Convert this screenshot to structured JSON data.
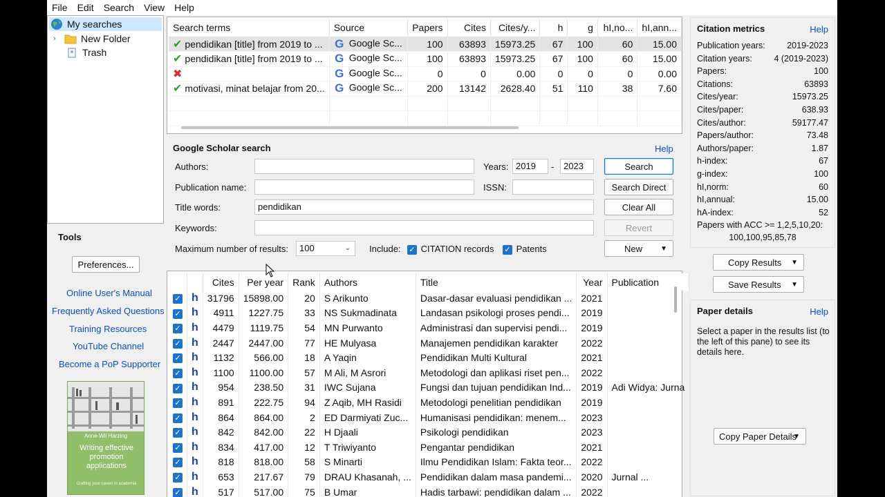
{
  "menu": [
    "File",
    "Edit",
    "Search",
    "View",
    "Help"
  ],
  "tree": [
    {
      "label": "My searches",
      "icon": "globe-icon"
    },
    {
      "label": "New Folder",
      "icon": "folder-icon"
    },
    {
      "label": "Trash",
      "icon": "trash-icon"
    }
  ],
  "tools": {
    "title": "Tools",
    "preferences": "Preferences...",
    "links": [
      "Online User's Manual",
      "Frequently Asked Questions",
      "Training Resources",
      "YouTube Channel",
      "Become a PoP Supporter"
    ],
    "book": {
      "author": "Anne-Wil Harzing",
      "title": "Writing effective promotion applications",
      "subtitle": "Crafting your career in academia"
    }
  },
  "searches": {
    "columns": [
      "Search terms",
      "Source",
      "Papers",
      "Cites",
      "Cites/y...",
      "h",
      "g",
      "hI,no...",
      "hI,ann..."
    ],
    "rows": [
      {
        "status": "ok",
        "terms": "pendidikan [title] from 2019 to ...",
        "source": "Google Sc...",
        "papers": "100",
        "cites": "63893",
        "cpy": "15973.25",
        "h": "67",
        "g": "100",
        "hinorm": "60",
        "hiann": "15.00"
      },
      {
        "status": "ok",
        "terms": "pendidikan [title] from 2019 to ...",
        "source": "Google Sc...",
        "papers": "100",
        "cites": "63893",
        "cpy": "15973.25",
        "h": "67",
        "g": "100",
        "hinorm": "60",
        "hiann": "15.00"
      },
      {
        "status": "error",
        "terms": "",
        "source": "Google Sc...",
        "papers": "0",
        "cites": "0",
        "cpy": "0.00",
        "h": "0",
        "g": "0",
        "hinorm": "0",
        "hiann": "0.00"
      },
      {
        "status": "ok",
        "terms": "motivasi, minat belajar from 20...",
        "source": "Google Sc...",
        "papers": "200",
        "cites": "13142",
        "cpy": "2628.40",
        "h": "51",
        "g": "110",
        "hinorm": "38",
        "hiann": "7.60"
      }
    ]
  },
  "gs": {
    "title": "Google Scholar search",
    "help": "Help",
    "authors_label": "Authors:",
    "authors_value": "",
    "pub_label": "Publication name:",
    "pub_value": "",
    "title_label": "Title words:",
    "title_value": "pendidikan",
    "keywords_label": "Keywords:",
    "keywords_value": "",
    "years_label": "Years:",
    "year_from": "2019",
    "year_dash": "-",
    "year_to": "2023",
    "issn_label": "ISSN:",
    "issn_value": "",
    "max_label": "Maximum number of results:",
    "max_value": "100",
    "include_label": "Include:",
    "citation_records": "CITATION records",
    "patents": "Patents",
    "btn_search": "Search",
    "btn_direct": "Search Direct",
    "btn_clear": "Clear All",
    "btn_revert": "Revert",
    "btn_new": "New"
  },
  "results": {
    "columns": [
      "Cites",
      "Per year",
      "Rank",
      "Authors",
      "Title",
      "Year",
      "Publication"
    ],
    "rows": [
      {
        "cites": "31796",
        "per_year": "15898.00",
        "rank": "20",
        "authors": "S Arikunto",
        "title": "Dasar-dasar evaluasi pendidikan ...",
        "year": "2021",
        "pub": ""
      },
      {
        "cites": "4911",
        "per_year": "1227.75",
        "rank": "33",
        "authors": "NS Sukmadinata",
        "title": "Landasan psikologi proses pendi...",
        "year": "2019",
        "pub": ""
      },
      {
        "cites": "4479",
        "per_year": "1119.75",
        "rank": "54",
        "authors": "MN Purwanto",
        "title": "Administrasi dan supervisi pendi...",
        "year": "2019",
        "pub": ""
      },
      {
        "cites": "2447",
        "per_year": "2447.00",
        "rank": "77",
        "authors": "HE Mulyasa",
        "title": "Manajemen pendidikan karakter",
        "year": "2022",
        "pub": ""
      },
      {
        "cites": "1132",
        "per_year": "566.00",
        "rank": "18",
        "authors": "A Yaqin",
        "title": "Pendidikan Multi Kultural",
        "year": "2021",
        "pub": ""
      },
      {
        "cites": "1100",
        "per_year": "1100.00",
        "rank": "57",
        "authors": "M Ali, M Asrori",
        "title": "Metodologi dan aplikasi riset pen...",
        "year": "2022",
        "pub": ""
      },
      {
        "cites": "954",
        "per_year": "238.50",
        "rank": "31",
        "authors": "IWC Sujana",
        "title": "Fungsi dan tujuan pendidikan Ind...",
        "year": "2019",
        "pub": "Adi Widya: Jurna"
      },
      {
        "cites": "891",
        "per_year": "222.75",
        "rank": "94",
        "authors": "Z Aqib, MH Rasidi",
        "title": "Metodologi penelitian pendidikan",
        "year": "2019",
        "pub": ""
      },
      {
        "cites": "864",
        "per_year": "864.00",
        "rank": "2",
        "authors": "ED Darmiyati Zuc...",
        "title": "Humanisasi pendidikan: menem...",
        "year": "2023",
        "pub": ""
      },
      {
        "cites": "842",
        "per_year": "842.00",
        "rank": "22",
        "authors": "H Djaali",
        "title": "Psikologi pendidikan",
        "year": "2023",
        "pub": ""
      },
      {
        "cites": "834",
        "per_year": "417.00",
        "rank": "12",
        "authors": "T Triwiyanto",
        "title": "Pengantar pendidikan",
        "year": "2021",
        "pub": ""
      },
      {
        "cites": "818",
        "per_year": "818.00",
        "rank": "58",
        "authors": "S Minarti",
        "title": "Ilmu Pendidikan Islam: Fakta teor...",
        "year": "2022",
        "pub": ""
      },
      {
        "cites": "653",
        "per_year": "217.67",
        "rank": "79",
        "authors": "DRAU Khasanah, ...",
        "title": "Pendidikan dalam masa pandemi...",
        "year": "2020",
        "pub": "Jurnal ..."
      },
      {
        "cites": "517",
        "per_year": "517.00",
        "rank": "75",
        "authors": "B Umar",
        "title": "Hadis tarbawi: pendidikan dalam ...",
        "year": "2022",
        "pub": ""
      }
    ]
  },
  "metrics": {
    "title": "Citation metrics",
    "help": "Help",
    "rows": [
      {
        "label": "Publication years:",
        "value": "2019-2023"
      },
      {
        "label": "Citation years:",
        "value": "4 (2019-2023)"
      },
      {
        "label": "Papers:",
        "value": "100"
      },
      {
        "label": "Citations:",
        "value": "63893"
      },
      {
        "label": "Cites/year:",
        "value": "15973.25"
      },
      {
        "label": "Cites/paper:",
        "value": "638.93"
      },
      {
        "label": "Cites/author:",
        "value": "59177.47"
      },
      {
        "label": "Papers/author:",
        "value": "73.48"
      },
      {
        "label": "Authors/paper:",
        "value": "1.87"
      },
      {
        "label": "h-index:",
        "value": "67"
      },
      {
        "label": "g-index:",
        "value": "100"
      },
      {
        "label": "hI,norm:",
        "value": "60"
      },
      {
        "label": "hI,annual:",
        "value": "15.00"
      },
      {
        "label": "hA-index:",
        "value": "52"
      }
    ],
    "acc_label": "Papers with ACC >= 1,2,5,10,20:",
    "acc_value": "100,100,95,85,78"
  },
  "actions": {
    "copy_results": "Copy Results",
    "save_results": "Save Results"
  },
  "details": {
    "title": "Paper details",
    "help": "Help",
    "text": "Select a paper in the results list (to the left of this pane) to see its details here.",
    "copy": "Copy Paper Details"
  },
  "colors": {
    "accent": "#0078d7",
    "link": "#0a4fbf",
    "check": "#1e73c8",
    "ok": "#2e9e2e",
    "error": "#d42d2d"
  }
}
